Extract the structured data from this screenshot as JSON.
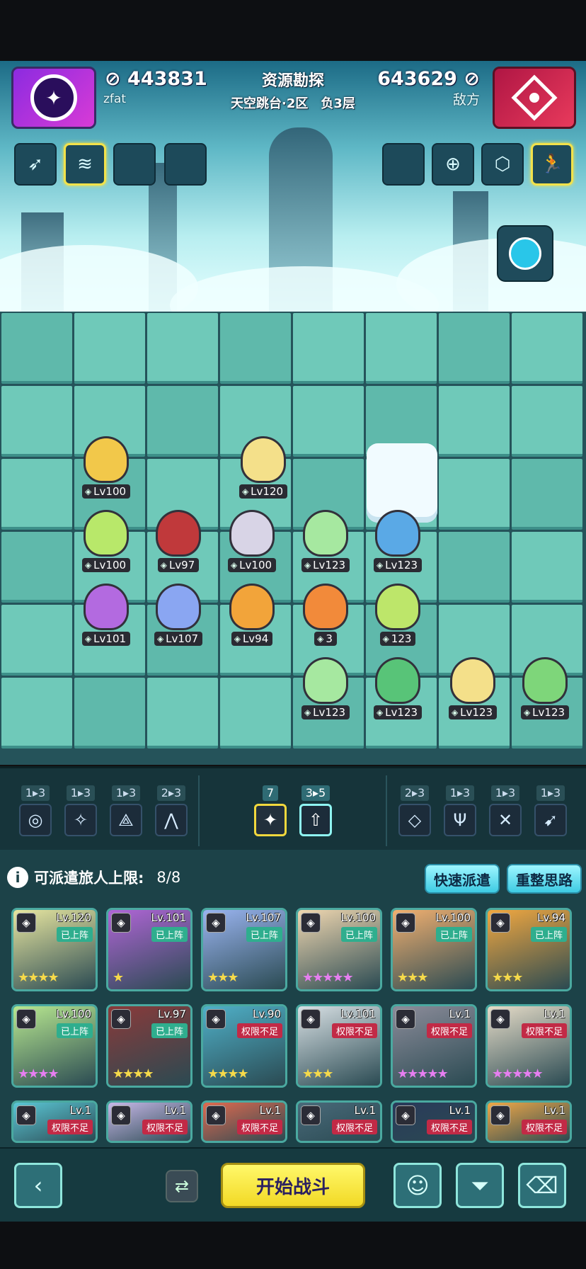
{
  "header": {
    "player_score": "443831",
    "player_name": "zfat",
    "enemy_score": "643629",
    "enemy_name": "敌方",
    "mode_title": "资源勘探",
    "mode_subtitle": "天空跳台·2区　负3层"
  },
  "skill_slots_left": [
    "arrow-burst-icon",
    "wave-icon",
    "",
    ""
  ],
  "skill_slots_right": [
    "",
    "crosshair-icon",
    "hex-icon",
    "runner-icon"
  ],
  "board_units": [
    {
      "level": "Lv100",
      "color": "#f2c84a"
    },
    {
      "level": "Lv120",
      "color": "#f4e08a"
    },
    {
      "level": "Lv100",
      "color": "#b8e86a"
    },
    {
      "level": "Lv97",
      "color": "#c0393b"
    },
    {
      "level": "Lv100",
      "color": "#d8d4e6"
    },
    {
      "level": "Lv123",
      "color": "#a6e8a0"
    },
    {
      "level": "Lv123",
      "color": "#5aa9e6"
    },
    {
      "level": "Lv101",
      "color": "#b36ae0"
    },
    {
      "level": "Lv107",
      "color": "#8aa6f2"
    },
    {
      "level": "Lv94",
      "color": "#f2a43a"
    },
    {
      "level": "3",
      "color": "#f28a3a"
    },
    {
      "level": "123",
      "color": "#bde66a"
    },
    {
      "level": "Lv123",
      "color": "#a6e8a0"
    },
    {
      "level": "Lv123",
      "color": "#58c478"
    },
    {
      "level": "Lv123",
      "color": "#f4e08a"
    },
    {
      "level": "Lv123",
      "color": "#7ed67a"
    }
  ],
  "factions_left": [
    {
      "count": "1▸3",
      "icon": "swirl-icon"
    },
    {
      "count": "1▸3",
      "icon": "shuriken-icon"
    },
    {
      "count": "1▸3",
      "icon": "blade-icon"
    },
    {
      "count": "2▸3",
      "icon": "mountain-icon"
    }
  ],
  "factions_mid": [
    {
      "count": "7",
      "icon": "star-burst-icon"
    },
    {
      "count": "3▸5",
      "icon": "arrow-up-icon"
    }
  ],
  "factions_right": [
    {
      "count": "2▸3",
      "icon": "chevron-icon"
    },
    {
      "count": "1▸3",
      "icon": "trident-icon"
    },
    {
      "count": "1▸3",
      "icon": "crossed-swords-icon"
    },
    {
      "count": "1▸3",
      "icon": "archer-icon"
    }
  ],
  "roster": {
    "limit_label": "可派遣旅人上限:",
    "limit_value": "8/8",
    "quick_button": "快速派遣",
    "reset_button": "重整思路",
    "cards": [
      {
        "level": "Lv.120",
        "tag": "已上阵",
        "stars": "★★★★",
        "color": "#e8e6a0"
      },
      {
        "level": "Lv.101",
        "tag": "已上阵",
        "stars": "★",
        "color": "#b065d6"
      },
      {
        "level": "Lv.107",
        "tag": "已上阵",
        "stars": "★★★",
        "color": "#9ab4f0"
      },
      {
        "level": "Lv.100",
        "tag": "已上阵",
        "stars": "★★★★★",
        "color": "#f0d7b0"
      },
      {
        "level": "Lv.100",
        "tag": "已上阵",
        "stars": "★★★",
        "color": "#f2b070"
      },
      {
        "level": "Lv.94",
        "tag": "已上阵",
        "stars": "★★★",
        "color": "#f2a840"
      },
      {
        "level": "Lv.100",
        "tag": "已上阵",
        "stars": "★★★★",
        "color": "#b8e890"
      },
      {
        "level": "Lv.97",
        "tag": "已上阵",
        "stars": "★★★★",
        "color": "#8a3a3a"
      },
      {
        "level": "Lv.90",
        "tag": "权限不足",
        "stars": "★★★★",
        "color": "#4fb0c8"
      },
      {
        "level": "Lv.101",
        "tag": "权限不足",
        "stars": "★★★",
        "color": "#d8e0e4"
      },
      {
        "level": "Lv.1",
        "tag": "权限不足",
        "stars": "★★★★★",
        "color": "#8c8c9a"
      },
      {
        "level": "Lv.1",
        "tag": "权限不足",
        "stars": "★★★★★",
        "color": "#e6dcc8"
      },
      {
        "level": "Lv.1",
        "tag": "权限不足",
        "stars": "",
        "color": "#5bc7d6"
      },
      {
        "level": "Lv.1",
        "tag": "权限不足",
        "stars": "",
        "color": "#c8b8e8"
      },
      {
        "level": "Lv.1",
        "tag": "权限不足",
        "stars": "",
        "color": "#e06a50"
      },
      {
        "level": "Lv.1",
        "tag": "权限不足",
        "stars": "",
        "color": "#4a6a7a"
      },
      {
        "level": "Lv.1",
        "tag": "权限不足",
        "stars": "",
        "color": "#2a3a5a"
      },
      {
        "level": "Lv.1",
        "tag": "权限不足",
        "stars": "",
        "color": "#f0a848"
      }
    ]
  },
  "bottom": {
    "start_label": "开始战斗"
  }
}
